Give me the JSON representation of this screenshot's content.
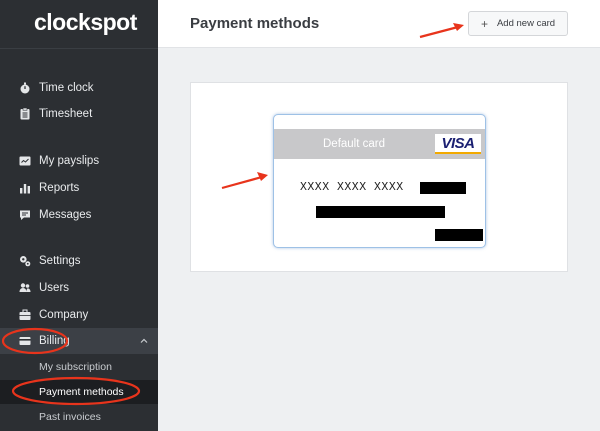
{
  "app": {
    "logo": "clockspot"
  },
  "sidebar": {
    "items": [
      {
        "label": "Time clock",
        "icon": "stopwatch-icon"
      },
      {
        "label": "Timesheet",
        "icon": "clipboard-icon"
      },
      {
        "label": "My payslips",
        "icon": "payslip-icon"
      },
      {
        "label": "Reports",
        "icon": "bar-chart-icon"
      },
      {
        "label": "Messages",
        "icon": "message-icon"
      },
      {
        "label": "Settings",
        "icon": "gears-icon"
      },
      {
        "label": "Users",
        "icon": "users-icon"
      },
      {
        "label": "Company",
        "icon": "briefcase-icon"
      },
      {
        "label": "Billing",
        "icon": "credit-card-icon",
        "expanded": true
      }
    ],
    "billing_sub": [
      {
        "label": "My subscription"
      },
      {
        "label": "Payment methods",
        "active": true
      },
      {
        "label": "Past invoices"
      }
    ]
  },
  "header": {
    "title": "Payment methods",
    "add_button": "Add new card",
    "add_icon": "+"
  },
  "card": {
    "label": "Default card",
    "brand": "VISA",
    "number_masked": "XXXX XXXX XXXX"
  },
  "colors": {
    "sidebar_bg": "#2c2f33",
    "annotation_red": "#e8341c",
    "visa_blue": "#1a1f71",
    "card_border": "#9ec1e6"
  }
}
